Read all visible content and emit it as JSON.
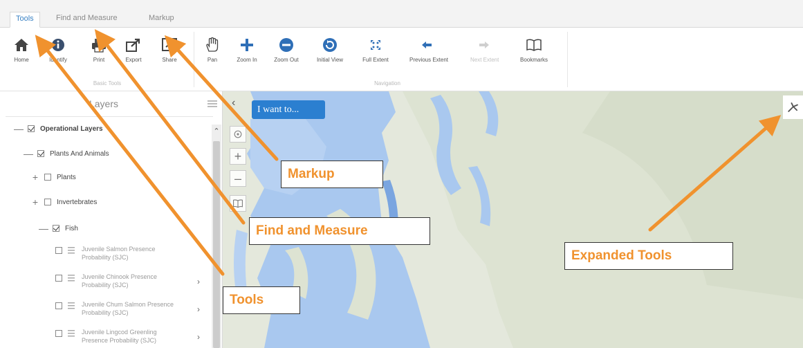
{
  "tabs": [
    {
      "label": "Tools"
    },
    {
      "label": "Find and Measure"
    },
    {
      "label": "Markup"
    }
  ],
  "toolbar": {
    "basic_group_label": "Basic Tools",
    "nav_group_label": "Navigation",
    "buttons": [
      {
        "label": "Home",
        "icon": "home-icon"
      },
      {
        "label": "Identify",
        "icon": "info-icon"
      },
      {
        "label": "Print",
        "icon": "printer-icon"
      },
      {
        "label": "Export",
        "icon": "export-icon"
      },
      {
        "label": "Share",
        "icon": "share-icon"
      },
      {
        "label": "Pan",
        "icon": "hand-icon"
      },
      {
        "label": "Zoom In",
        "icon": "zoom-in-icon"
      },
      {
        "label": "Zoom Out",
        "icon": "zoom-out-icon"
      },
      {
        "label": "Initial View",
        "icon": "initial-view-icon"
      },
      {
        "label": "Full Extent",
        "icon": "full-extent-icon"
      },
      {
        "label": "Previous Extent",
        "icon": "previous-extent-icon"
      },
      {
        "label": "Next Extent",
        "icon": "next-extent-icon"
      },
      {
        "label": "Bookmarks",
        "icon": "bookmarks-icon"
      }
    ]
  },
  "layers_panel": {
    "title": "Layers",
    "tree": [
      {
        "label": "Operational Layers",
        "toggle": "—",
        "checked": true
      },
      {
        "label": "Plants And Animals",
        "toggle": "—",
        "checked": true
      },
      {
        "label": "Plants",
        "toggle": "+",
        "checked": false
      },
      {
        "label": "Invertebrates",
        "toggle": "+",
        "checked": false
      },
      {
        "label": "Fish",
        "toggle": "—",
        "checked": true
      }
    ],
    "fish_layers": [
      {
        "label": "Juvenile Salmon Presence Probability (SJC)"
      },
      {
        "label": "Juvenile Chinook Presence Probability (SJC)"
      },
      {
        "label": "Juvenile Chum Salmon Presence Probability (SJC)"
      },
      {
        "label": "Juvenile Lingcod Greenling Presence Probability (SJC)"
      }
    ]
  },
  "map": {
    "i_want_to_label": "I want to..."
  },
  "annotations": {
    "markup": "Markup",
    "find_and_measure": "Find and Measure",
    "tools": "Tools",
    "expanded_tools": "Expanded Tools"
  },
  "colors": {
    "accent": "#2b7fd0",
    "annotation": "#f0922e",
    "water": "#a9c8ef"
  }
}
